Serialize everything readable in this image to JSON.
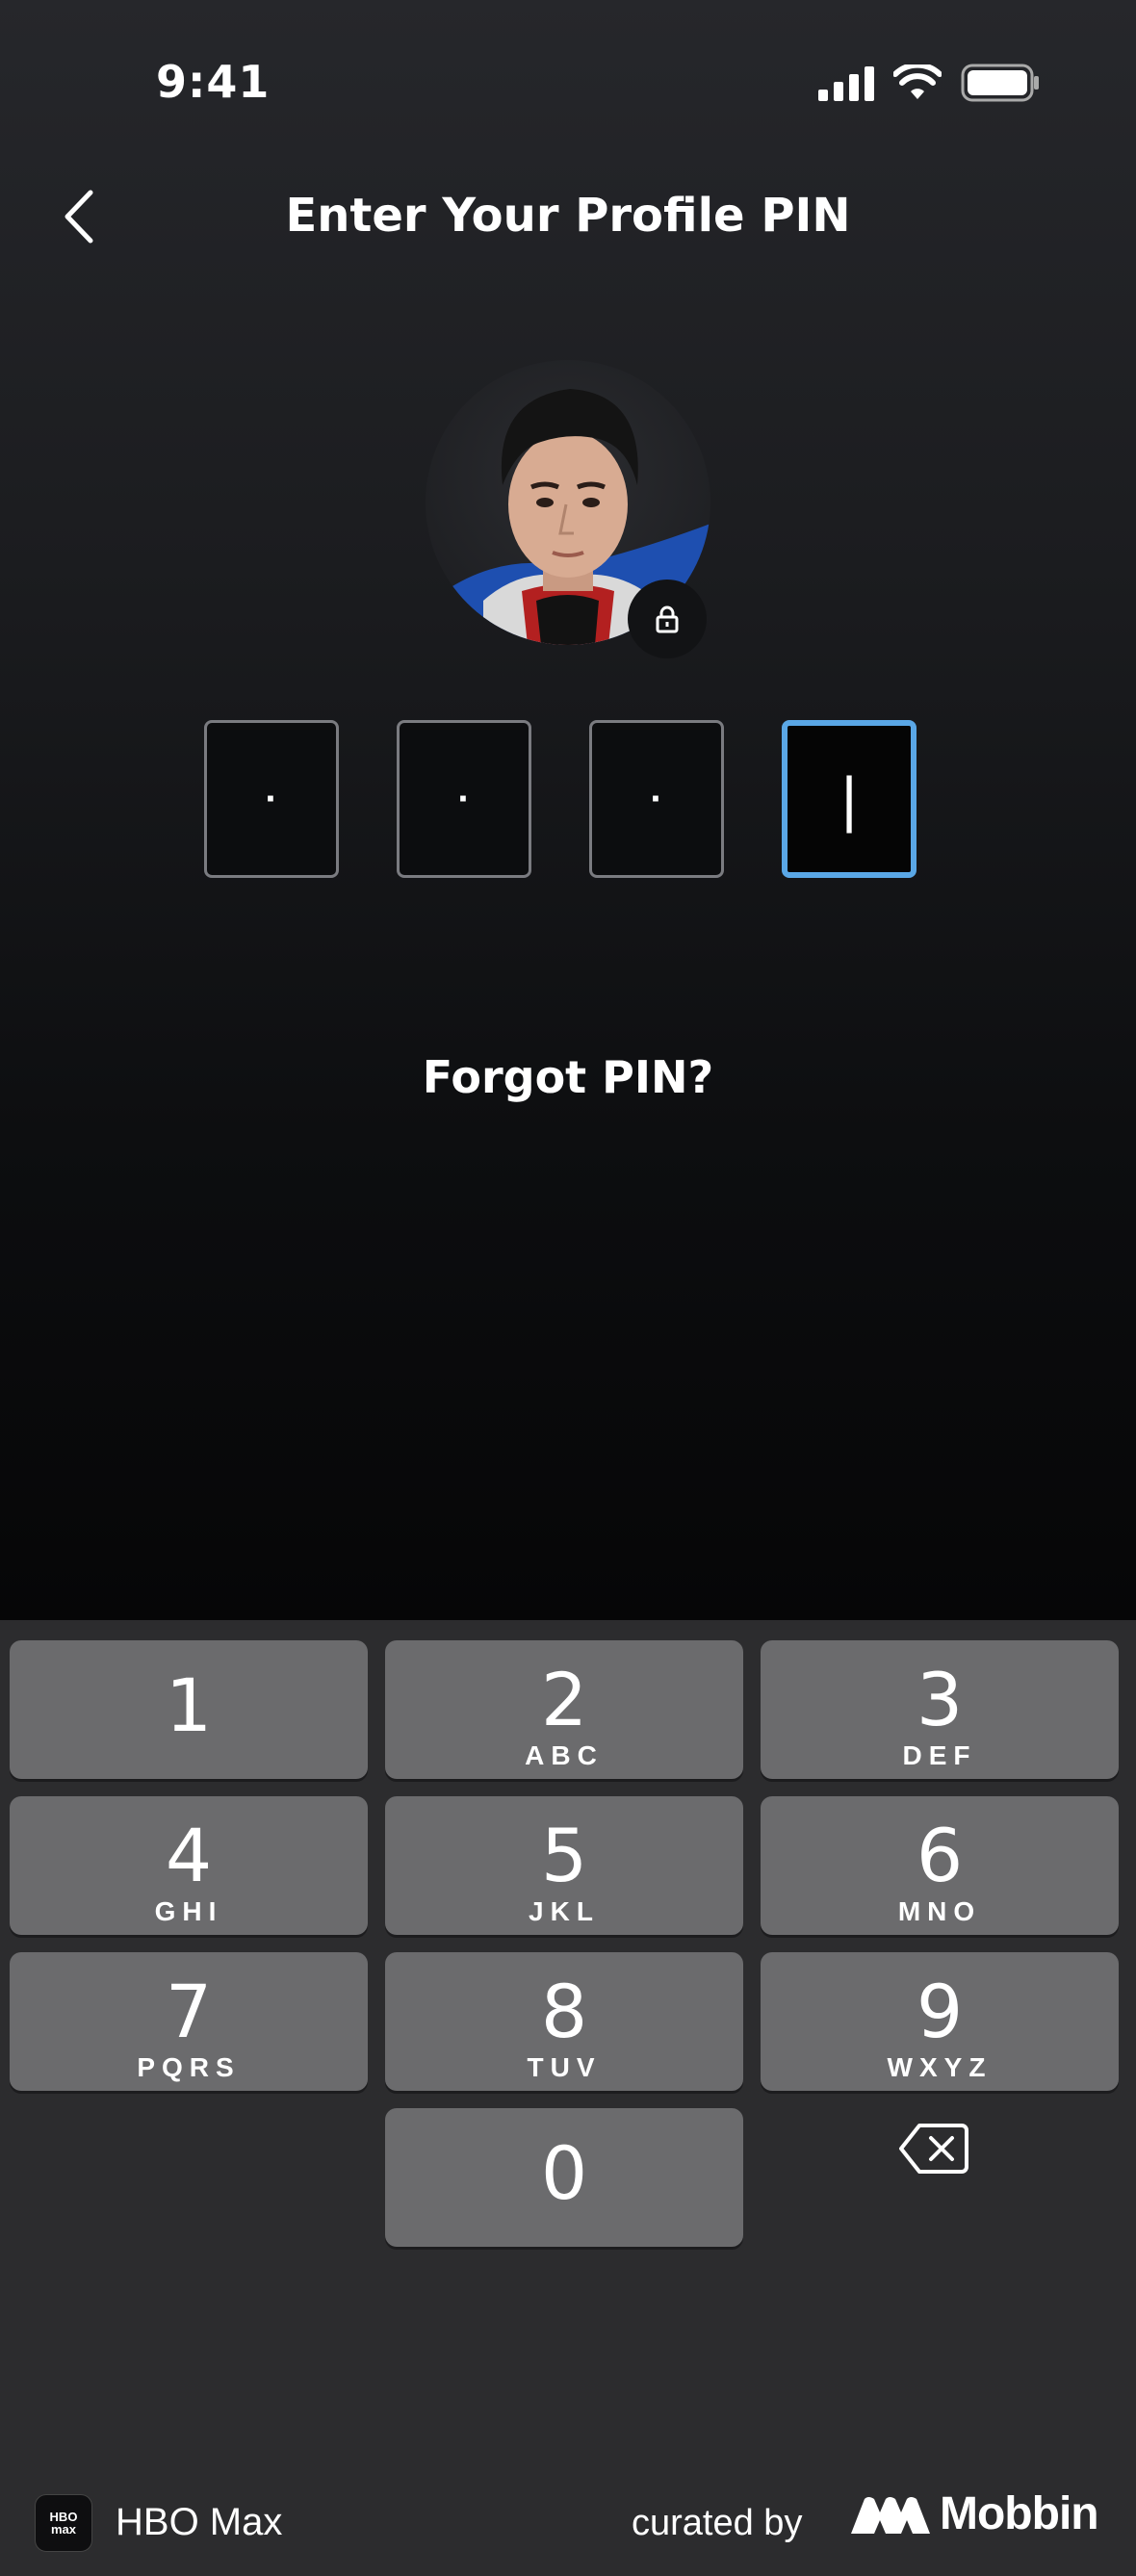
{
  "status_bar": {
    "time": "9:41"
  },
  "header": {
    "title": "Enter Your Profile PIN"
  },
  "pin": {
    "digits": [
      "·",
      "·",
      "·",
      "|"
    ]
  },
  "forgot_pin": "Forgot PIN?",
  "keypad": {
    "keys": [
      {
        "num": "1",
        "letters": ""
      },
      {
        "num": "2",
        "letters": "ABC"
      },
      {
        "num": "3",
        "letters": "DEF"
      },
      {
        "num": "4",
        "letters": "GHI"
      },
      {
        "num": "5",
        "letters": "JKL"
      },
      {
        "num": "6",
        "letters": "MNO"
      },
      {
        "num": "7",
        "letters": "PQRS"
      },
      {
        "num": "8",
        "letters": "TUV"
      },
      {
        "num": "9",
        "letters": "WXYZ"
      },
      {
        "num": "0",
        "letters": ""
      }
    ]
  },
  "footer": {
    "app_logo_text": "HBO max",
    "app_name": "HBO Max",
    "curated_by": "curated by",
    "mobbin": "Mobbin"
  },
  "colors": {
    "active_pin_border": "#5aa7e6",
    "key_bg": "#6b6b6d",
    "keypad_bg": "#2c2c2e"
  }
}
